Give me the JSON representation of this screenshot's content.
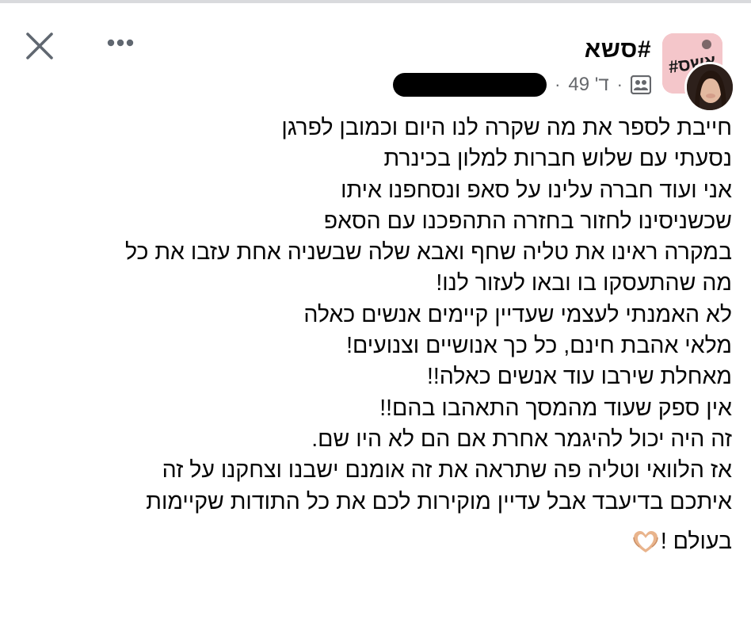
{
  "header": {
    "group_name": "סשא#",
    "meta": {
      "time": "49 'ד",
      "separator": "·",
      "privacy_icon": "group-members-icon",
      "author_redacted": true
    },
    "close_icon": "close-icon",
    "more_icon": "more-options-icon"
  },
  "post": {
    "lines": [
      "חייבת לספר את מה שקרה לנו היום וכמובן לפרגן",
      "נסעתי עם שלוש חברות למלון בכינרת",
      "אני ועוד חברה עלינו על סאפ ונסחפנו איתו",
      "שכשניסינו לחזור בחזרה התהפכנו עם הסאפ",
      "במקרה ראינו את טליה שחף ואבא שלה שבשניה אחת עזבו את כל",
      "מה שהתעסקו בו ובאו לעזור לנו!",
      "לא האמנתי לעצמי שעדיין קיימים אנשים כאלה",
      "מלאי אהבת חינם, כל כך אנושיים וצנועים!",
      "מאחלת שירבו עוד אנשים כאלה!!",
      "אין ספק שעוד מהמסך התאהבו בהם!!",
      "זה היה יכול להיגמר אחרת אם הם לא היו שם.",
      "אז הלוואי וטליה פה שתראה את זה אומנם ישבנו וצחקנו על זה",
      "איתכם בדיעבד אבל עדיין מוקירות לכם את כל התודות שקיימות"
    ],
    "last_line_text": "בעולם !",
    "last_line_emoji": "heart-hands-icon"
  },
  "colors": {
    "text": "#050505",
    "meta": "#65676b",
    "group_avatar_bg": "#f4c6ca",
    "top_rule": "#d9dadd"
  }
}
